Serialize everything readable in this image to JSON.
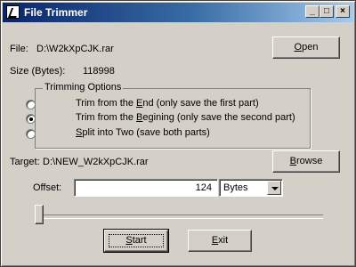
{
  "window": {
    "title": "File Trimmer",
    "minimize_label": "_",
    "maximize_label": "□",
    "close_label": "×"
  },
  "file": {
    "label": "File:",
    "path": "D:\\W2kXpCJK.rar",
    "size_label": "Size (Bytes):",
    "size_value": "118998",
    "open_button": {
      "pre": "",
      "accel": "O",
      "post": "pen"
    }
  },
  "trimming": {
    "legend": "Trimming Options",
    "options": [
      {
        "pre": "Trim from the ",
        "accel": "E",
        "post": "nd (only save the first part)",
        "checked": false
      },
      {
        "pre": "Trim from the ",
        "accel": "B",
        "post": "egining (only save the second part)",
        "checked": true
      },
      {
        "pre": "",
        "accel": "S",
        "post": "plit into Two (save both parts)",
        "checked": false
      }
    ]
  },
  "target": {
    "label": "Target:",
    "path": "D:\\NEW_W2kXpCJK.rar",
    "browse_button": {
      "pre": "",
      "accel": "B",
      "post": "rowse"
    }
  },
  "offset": {
    "label": "Offset:",
    "value": "124",
    "unit": "Bytes"
  },
  "slider": {
    "position_fraction": 0.0
  },
  "actions": {
    "start": {
      "pre": "",
      "accel": "S",
      "post": "tart"
    },
    "exit": {
      "pre": "",
      "accel": "E",
      "post": "xit"
    }
  }
}
